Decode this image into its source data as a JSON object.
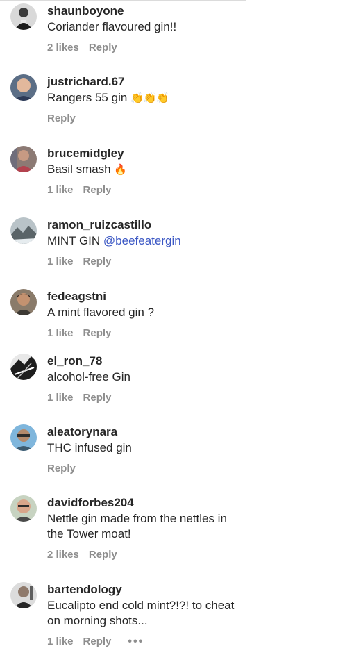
{
  "comments": [
    {
      "username": "shaunboyone",
      "text": "Coriander flavoured gin!!",
      "likes": "2 likes",
      "reply": "Reply"
    },
    {
      "username": "justrichard.67",
      "text": "Rangers 55 gin",
      "emoji": "👏👏👏",
      "reply": "Reply"
    },
    {
      "username": "brucemidgley",
      "text": "Basil smash",
      "emoji": "🔥",
      "likes": "1 like",
      "reply": "Reply"
    },
    {
      "username": "ramon_ruizcastillo",
      "text": "MINT GIN",
      "mention": "@beefeatergin",
      "likes": "1 like",
      "reply": "Reply"
    },
    {
      "username": "fedeagstni",
      "text": "A mint flavored gin ?",
      "likes": "1 like",
      "reply": "Reply"
    },
    {
      "username": "el_ron_78",
      "text": "alcohol-free Gin",
      "likes": "1 like",
      "reply": "Reply"
    },
    {
      "username": "aleatorynara",
      "text": "THC infused gin",
      "reply": "Reply"
    },
    {
      "username": "davidforbes204",
      "text_line1": "Nettle gin made from the nettles in",
      "text_line2": "the Tower moat!",
      "likes": "2 likes",
      "reply": "Reply"
    },
    {
      "username": "bartendology",
      "text_line1": "Eucalipto end cold mint?!?! to cheat",
      "text_line2": "on morning shots...",
      "likes": "1 like",
      "reply": "Reply",
      "more": "•••"
    }
  ]
}
